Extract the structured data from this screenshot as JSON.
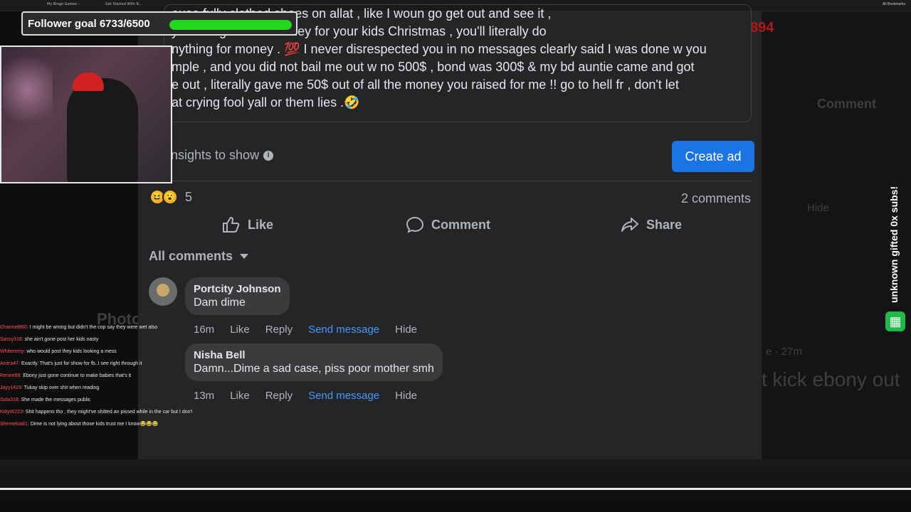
{
  "browser": {
    "tabs": [
      "My Bingo Games –",
      "Get Started With R..."
    ],
    "bookmarks_label": "All Bookmarks"
  },
  "background": {
    "comment_label": "Comment",
    "hide_label": "Hide",
    "photo_label": "Photo",
    "time_label": "e · 27m",
    "headline_fragment": "t kick ebony out",
    "viewer_count": "894"
  },
  "post": {
    "lines": [
      "ouse fully clothed shoes on allat , like I woun go get out and see it ,",
      "y line to get extra money for your kids Christmas , you'll literally do",
      "nything for money . 💯 I never disrespected you in no messages clearly said I was done w you",
      "mple , and you did not bail me out w no 500$ , bond was 300$ & my bd auntie came and got",
      "e out , literally gave me 50$ out of all the money you raised for me !! go to hell fr , don't let",
      "at crying fool yall or them lies .🤣"
    ]
  },
  "insights": {
    "text": "nsights to show",
    "create_ad_label": "Create ad"
  },
  "reactions": {
    "count": "5",
    "comments_count": "2 comments"
  },
  "actions": {
    "like": "Like",
    "comment": "Comment",
    "share": "Share"
  },
  "comments_section": {
    "filter_label": "All comments",
    "comments": [
      {
        "author": "Portcity Johnson",
        "text": "Dam dime",
        "time": "16m",
        "like": "Like",
        "reply": "Reply",
        "send_message": "Send message",
        "hide": "Hide"
      },
      {
        "author": "Nisha Bell",
        "text": "Damn...Dime a sad case, piss poor mother smh",
        "time": "13m",
        "like": "Like",
        "reply": "Reply",
        "send_message": "Send message",
        "hide": "Hide"
      }
    ]
  },
  "stream_overlay": {
    "follower_goal": "Follower goal 6733/6500",
    "follower_progress": 1.0,
    "sub_alert": "unknown gifted 0x subs!",
    "chat": [
      {
        "user": "Channel860:",
        "msg": "I might be wrong but didn't the cop say they were wet also"
      },
      {
        "user": "Sassy318:",
        "msg": "she ain't gone post her kids nasty"
      },
      {
        "user": "Whiteremy:",
        "msg": "who would post they kids looking a mess"
      },
      {
        "user": "Anitra47:",
        "msg": "Exactly. That's just for show for fb..I see right through it"
      },
      {
        "user": "Renee89:",
        "msg": "Ebony just gone continue to make babies that's it"
      },
      {
        "user": "Jayy1429:",
        "msg": "Tukay skip over shit when reading"
      },
      {
        "user": "Sola318:",
        "msg": "She made the messages public"
      },
      {
        "user": "KittyW223:",
        "msg": "Shit happens tho , they might've shitted an pissed while in the car but I don't think she's a bad mother she just got a lot on her plate"
      },
      {
        "user": "Shemekia81:",
        "msg": "Dime is not lying about those kids trust me I know😂😂😂"
      }
    ]
  },
  "colors": {
    "accent": "#1b74e4",
    "link": "#4599ff",
    "progress": "#22d81d",
    "modal_bg": "#242526"
  }
}
